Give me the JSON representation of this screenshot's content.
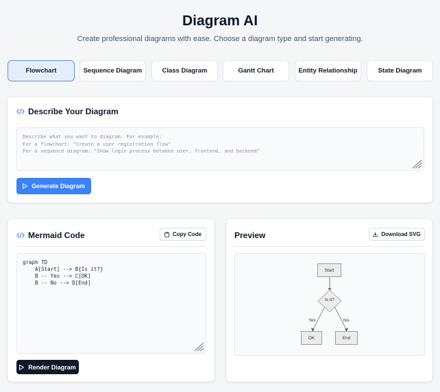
{
  "header": {
    "title": "Diagram AI",
    "subtitle": "Create professional diagrams with ease. Choose a diagram type and start generating."
  },
  "tabs": [
    {
      "label": "Flowchart",
      "active": true
    },
    {
      "label": "Sequence Diagram",
      "active": false
    },
    {
      "label": "Class Diagram",
      "active": false
    },
    {
      "label": "Gantt Chart",
      "active": false
    },
    {
      "label": "Entity Relationship",
      "active": false
    },
    {
      "label": "State Diagram",
      "active": false
    }
  ],
  "describe": {
    "title": "Describe Your Diagram",
    "placeholder": "Describe what you want to diagram. For example:\nFor a flowchart: \"Create a user registration flow\"\nFor a sequence diagram: \"Show login process between user, frontend, and backend\"",
    "generate_label": "Generate Diagram"
  },
  "mermaid": {
    "title": "Mermaid Code",
    "copy_label": "Copy Code",
    "code": "graph TD\n    A[Start] --> B{Is it?}\n    B -- Yes --> C[OK]\n    B -- No --> D[End]",
    "render_label": "Render Diagram"
  },
  "preview": {
    "title": "Preview",
    "download_label": "Download SVG",
    "diagram": {
      "start": "Start",
      "decision": "Is it?",
      "ok": "OK",
      "end": "End",
      "yes": "Yes",
      "no": "No"
    }
  },
  "colors": {
    "accent": "#3b82f6",
    "active_tab_bg": "#e4eefb",
    "dark_button": "#111827"
  },
  "icons": {
    "code": "code-brackets-icon",
    "play": "play-icon",
    "copy": "clipboard-icon",
    "download": "download-icon"
  }
}
